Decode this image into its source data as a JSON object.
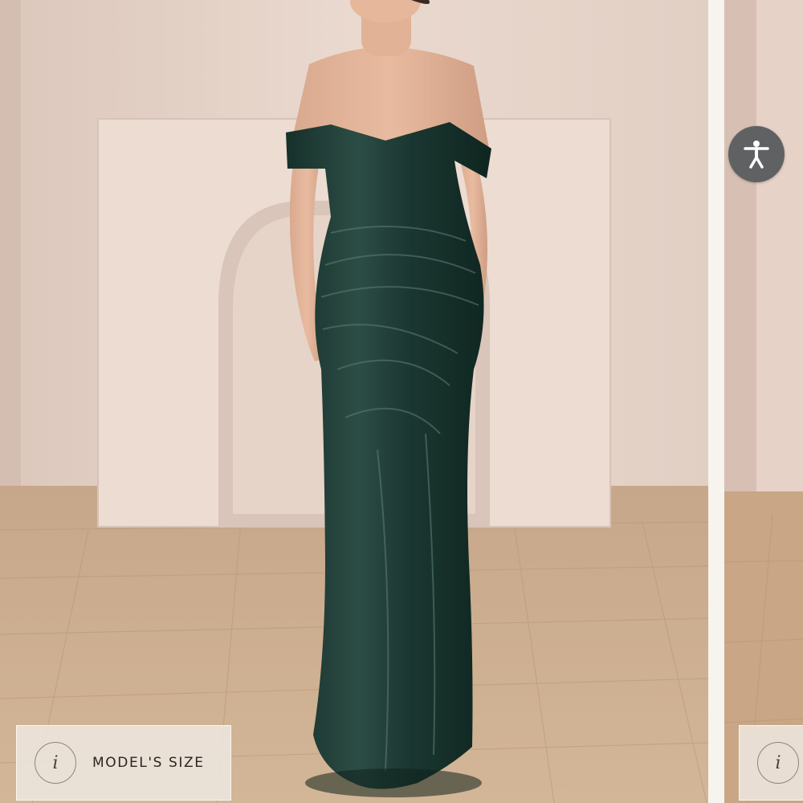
{
  "product_gallery": {
    "current_image_alt": "Model wearing an off-the-shoulder dark green velvet gown",
    "next_image_alt": "Next product image",
    "model_size_button": {
      "label": "MODEL'S SIZE",
      "icon": "info-icon",
      "icon_glyph": "i"
    },
    "next_model_size_button": {
      "icon": "info-icon",
      "icon_glyph": "i"
    }
  },
  "accessibility_button": {
    "icon": "accessibility-person-icon",
    "color": "#5f6163"
  },
  "colors": {
    "wall": "#e8d7cd",
    "floor": "#c9a988",
    "dress": "#1e3a33",
    "background": "#f7f3ef"
  }
}
